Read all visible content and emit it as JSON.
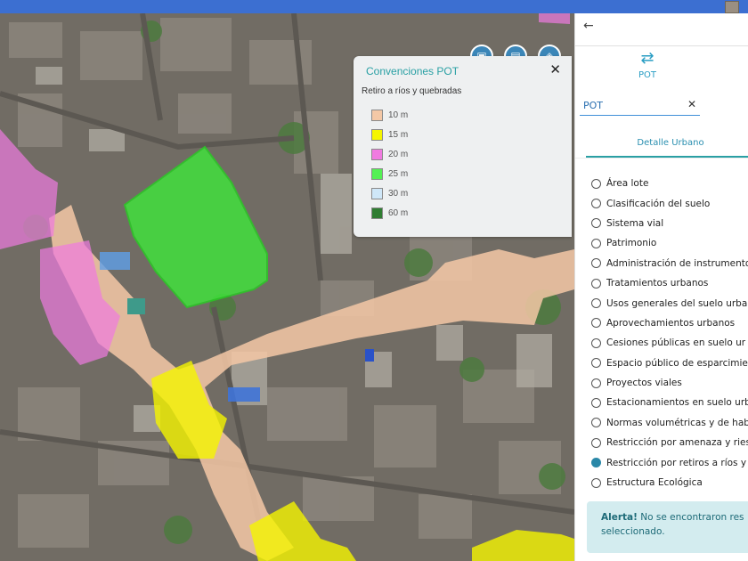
{
  "legend": {
    "title": "Convenciones POT",
    "subtitle": "Retiro a ríos y quebradas",
    "close_icon": "close-icon",
    "items": [
      {
        "label": "10 m",
        "color": "#f4c8a6"
      },
      {
        "label": "15 m",
        "color": "#f5f500"
      },
      {
        "label": "20 m",
        "color": "#f07be0"
      },
      {
        "label": "25 m",
        "color": "#54f054"
      },
      {
        "label": "30 m",
        "color": "#cfe7f8"
      },
      {
        "label": "60 m",
        "color": "#2f7d32"
      }
    ]
  },
  "panel": {
    "back_icon": "arrow-left-icon",
    "pot_tab": {
      "label": "POT",
      "icon": "route-icon"
    },
    "search": {
      "value": "POT",
      "clear_icon": "close-icon"
    },
    "subtab": "Detalle Urbano",
    "options": [
      {
        "label": "Área lote",
        "selected": false
      },
      {
        "label": "Clasificación del suelo",
        "selected": false
      },
      {
        "label": "Sistema vial",
        "selected": false
      },
      {
        "label": "Patrimonio",
        "selected": false
      },
      {
        "label": "Administración de instrumento",
        "selected": false
      },
      {
        "label": "Tratamientos urbanos",
        "selected": false
      },
      {
        "label": "Usos generales del suelo urba",
        "selected": false
      },
      {
        "label": "Aprovechamientos urbanos",
        "selected": false
      },
      {
        "label": "Cesiones públicas en suelo ur",
        "selected": false
      },
      {
        "label": "Espacio público de esparcimie",
        "selected": false
      },
      {
        "label": "Proyectos viales",
        "selected": false
      },
      {
        "label": "Estacionamientos en suelo urb",
        "selected": false
      },
      {
        "label": "Normas volumétricas y de hab",
        "selected": false
      },
      {
        "label": "Restricción por amenaza y ries",
        "selected": false
      },
      {
        "label": "Restricción por retiros a ríos y",
        "selected": true
      },
      {
        "label": "Estructura Ecológica",
        "selected": false
      }
    ],
    "alert": {
      "strong": "Alerta!",
      "text": " No se encontraron res",
      "text2": "seleccionado."
    }
  },
  "map": {
    "controls": [
      "print-icon",
      "map-icon",
      "layers-icon"
    ],
    "colors": {
      "river_buffer": "#f4c8a6",
      "yellow_zone": "#f5f500",
      "pink_zone": "#f07be0",
      "green_zone": "#3ee83a"
    }
  }
}
